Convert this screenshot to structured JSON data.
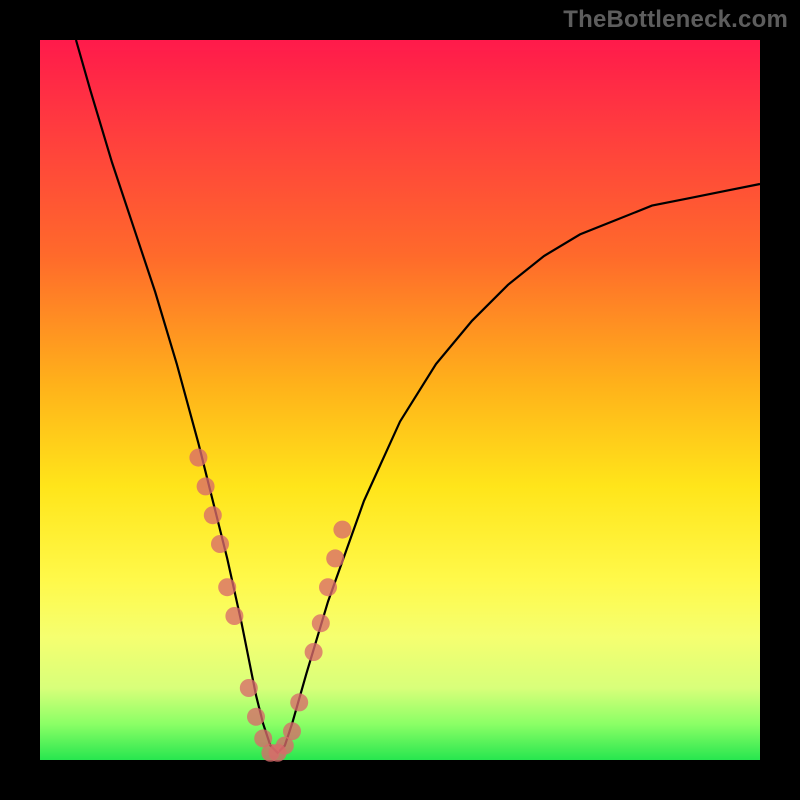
{
  "watermark": "TheBottleneck.com",
  "chart_data": {
    "type": "line",
    "title": "",
    "xlabel": "",
    "ylabel": "",
    "xlim": [
      0,
      100
    ],
    "ylim": [
      0,
      100
    ],
    "grid": false,
    "series": [
      {
        "name": "curve",
        "x": [
          5,
          7,
          10,
          13,
          16,
          19,
          22,
          24,
          26,
          28,
          29,
          30,
          31,
          32,
          33,
          34,
          35,
          37,
          40,
          45,
          50,
          55,
          60,
          65,
          70,
          75,
          80,
          85,
          90,
          95,
          100
        ],
        "y": [
          100,
          93,
          83,
          74,
          65,
          55,
          44,
          36,
          28,
          19,
          14,
          9,
          5,
          2,
          1,
          2,
          5,
          12,
          22,
          36,
          47,
          55,
          61,
          66,
          70,
          73,
          75,
          77,
          78,
          79,
          80
        ]
      }
    ],
    "points": {
      "name": "dots",
      "x": [
        22,
        23,
        24,
        25,
        26,
        27,
        29,
        30,
        31,
        32,
        33,
        34,
        35,
        36,
        38,
        39,
        40,
        41,
        42
      ],
      "y": [
        42,
        38,
        34,
        30,
        24,
        20,
        10,
        6,
        3,
        1,
        1,
        2,
        4,
        8,
        15,
        19,
        24,
        28,
        32
      ]
    }
  }
}
